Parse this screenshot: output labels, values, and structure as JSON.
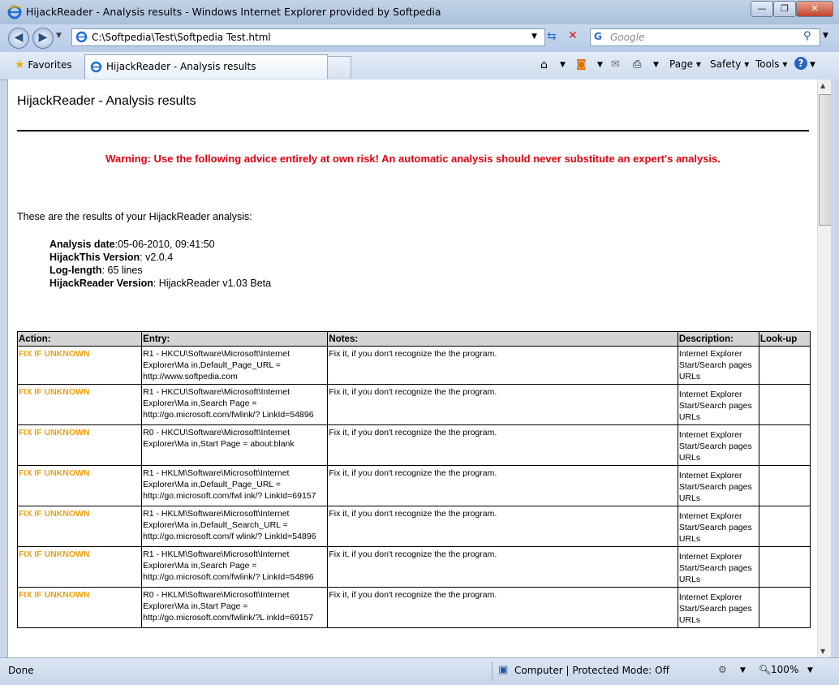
{
  "window": {
    "title": "HijackReader - Analysis results - Windows Internet Explorer provided by Softpedia",
    "minimize": "—",
    "maximize": "❐",
    "close": "✕"
  },
  "address_bar": {
    "url": "C:\\Softpedia\\Test\\Softpedia Test.html",
    "search_placeholder": "Google"
  },
  "command_bar": {
    "favorites": "Favorites",
    "tab_title": "HijackReader - Analysis results",
    "page": "Page",
    "safety": "Safety",
    "tools": "Tools",
    "help": "?"
  },
  "page": {
    "title": "HijackReader - Analysis results",
    "warning": "Warning: Use the following advice entirely at own risk! An automatic analysis should never substitute an expert's analysis.",
    "intro": "These are the results of your HijackReader analysis:",
    "info": {
      "date_label": "Analysis date",
      "date_value": ":05-06-2010, 09:41:50",
      "ht_label": "HijackThis Version",
      "ht_value": ": v2.0.4",
      "log_label": "Log-length",
      "log_value": ": 65 lines",
      "hr_label": "HijackReader Version",
      "hr_value": ": HijackReader v1.03 Beta"
    },
    "table": {
      "headers": [
        "Action:",
        "Entry:",
        "Notes:",
        "Description:",
        "Look-up"
      ],
      "rows": [
        {
          "action": "FIX IF UNKNOWN",
          "entry": "R1 - HKCU\\Software\\Microsoft\\Internet Explorer\\Ma in,Default_Page_URL = http://www.softpedia.com",
          "notes": "Fix it, if you don't recognize the the program.",
          "desc": "Internet Explorer Start/Search pages URLs"
        },
        {
          "action": "FIX IF UNKNOWN",
          "entry": "R1 - HKCU\\Software\\Microsoft\\Internet Explorer\\Ma in,Search Page = http://go.microsoft.com/fwlink/? LinkId=54896",
          "notes": "Fix it, if you don't recognize the the program.",
          "desc": "Internet Explorer Start/Search pages URLs"
        },
        {
          "action": "FIX IF UNKNOWN",
          "entry": "R0 - HKCU\\Software\\Microsoft\\Internet Explorer\\Ma in,Start Page = about:blank",
          "notes": "Fix it, if you don't recognize the the program.",
          "desc": "Internet Explorer Start/Search pages URLs"
        },
        {
          "action": "FIX IF UNKNOWN",
          "entry": "R1 - HKLM\\Software\\Microsoft\\Internet Explorer\\Ma in,Default_Page_URL = http://go.microsoft.com/fwl ink/? LinkId=69157",
          "notes": "Fix it, if you don't recognize the the program.",
          "desc": "Internet Explorer Start/Search pages URLs"
        },
        {
          "action": "FIX IF UNKNOWN",
          "entry": "R1 - HKLM\\Software\\Microsoft\\Internet Explorer\\Ma in,Default_Search_URL = http://go.microsoft.com/f wlink/? LinkId=54896",
          "notes": "Fix it, if you don't recognize the the program.",
          "desc": "Internet Explorer Start/Search pages URLs"
        },
        {
          "action": "FIX IF UNKNOWN",
          "entry": "R1 - HKLM\\Software\\Microsoft\\Internet Explorer\\Ma in,Search Page = http://go.microsoft.com/fwlink/? LinkId=54896",
          "notes": "Fix it, if you don't recognize the the program.",
          "desc": "Internet Explorer Start/Search pages URLs"
        },
        {
          "action": "FIX IF UNKNOWN",
          "entry": "R0 - HKLM\\Software\\Microsoft\\Internet Explorer\\Ma in,Start Page = http://go.microsoft.com/fwlink/?L inkId=69157",
          "notes": "Fix it, if you don't recognize the the program.",
          "desc": "Internet Explorer Start/Search pages URLs"
        }
      ]
    }
  },
  "status_bar": {
    "status": "Done",
    "zone": "Computer | Protected Mode: Off",
    "zoom": "100%"
  },
  "colors": {
    "warning": "#e3000f",
    "action": "#f2a00a"
  },
  "icons": [
    "ie-logo-icon",
    "back-icon",
    "forward-icon",
    "refresh-icon",
    "stop-icon",
    "google-icon",
    "search-icon",
    "favorites-star-icon",
    "home-icon",
    "rss-feed-icon",
    "read-mail-icon",
    "print-icon",
    "help-icon",
    "computer-zone-icon",
    "zoom-icon"
  ]
}
